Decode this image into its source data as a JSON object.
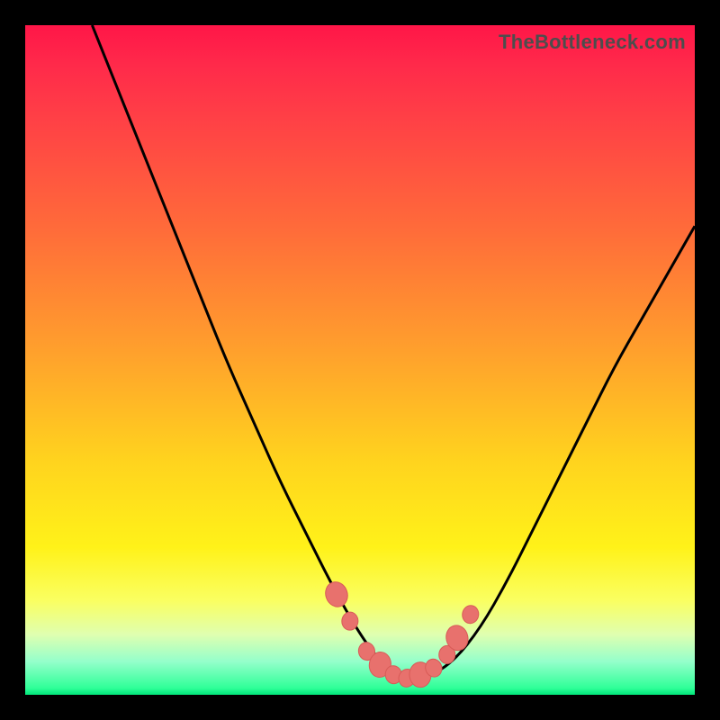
{
  "watermark": "TheBottleneck.com",
  "colors": {
    "frame": "#000000",
    "curve": "#000000",
    "marker_fill": "#e8716d",
    "marker_stroke": "#d85b57",
    "gradient_top": "#ff1648",
    "gradient_bottom": "#00e67a"
  },
  "chart_data": {
    "type": "line",
    "title": "",
    "xlabel": "",
    "ylabel": "",
    "xlim": [
      0,
      100
    ],
    "ylim": [
      0,
      100
    ],
    "grid": false,
    "legend": false,
    "series": [
      {
        "name": "bottleneck-curve",
        "x": [
          10,
          14,
          18,
          22,
          26,
          30,
          34,
          38,
          42,
          46,
          50,
          53,
          56,
          58,
          60,
          64,
          68,
          72,
          76,
          80,
          84,
          88,
          92,
          96,
          100
        ],
        "y": [
          100,
          90,
          80,
          70,
          60,
          50,
          41,
          32,
          24,
          16,
          9,
          5,
          2.5,
          2,
          2.5,
          5,
          10,
          17,
          25,
          33,
          41,
          49,
          56,
          63,
          70
        ]
      }
    ],
    "markers": {
      "name": "highlight-points",
      "x": [
        46.5,
        48.5,
        51,
        53,
        55,
        57,
        59,
        61,
        63,
        64.5,
        66.5
      ],
      "y": [
        15,
        11,
        6.5,
        4.5,
        3,
        2.5,
        3,
        4,
        6,
        8.5,
        12
      ]
    }
  }
}
